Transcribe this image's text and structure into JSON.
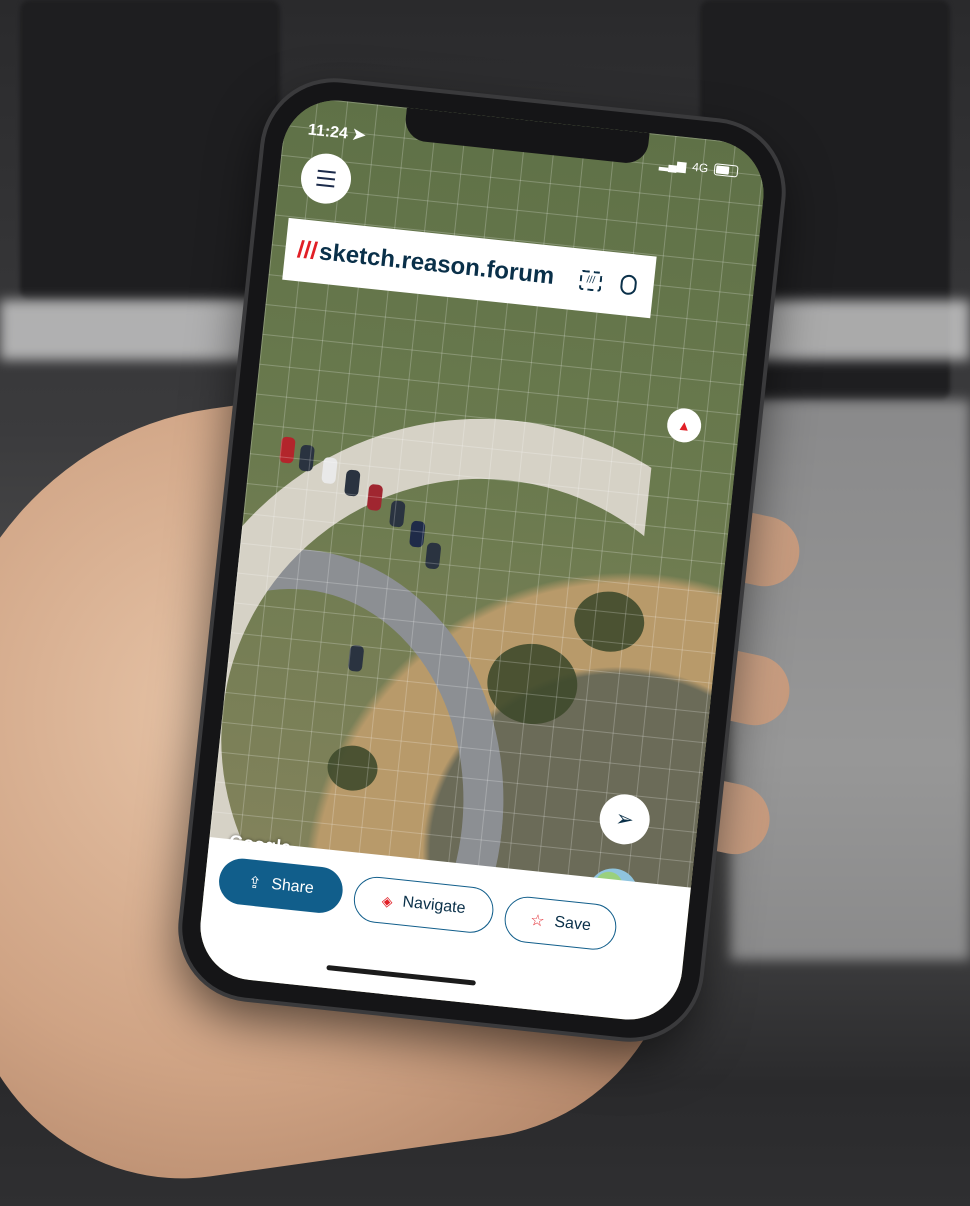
{
  "status_bar": {
    "time": "11:24",
    "signal": "4G"
  },
  "search": {
    "slashes": "///",
    "address": "sketch.reason.forum"
  },
  "map": {
    "attribution": "Google"
  },
  "actions": {
    "share_label": "Share",
    "navigate_label": "Navigate",
    "save_label": "Save"
  },
  "icons": {
    "menu": "menu-icon",
    "scan": "scan-icon",
    "mic": "microphone-icon",
    "compass": "compass-icon",
    "locate": "location-arrow-icon",
    "globe": "globe-icon",
    "share": "share-icon",
    "navigate": "navigate-icon",
    "save": "star-icon"
  },
  "colors": {
    "primary": "#115e8b",
    "accent": "#e11f26",
    "text": "#0a3049"
  }
}
